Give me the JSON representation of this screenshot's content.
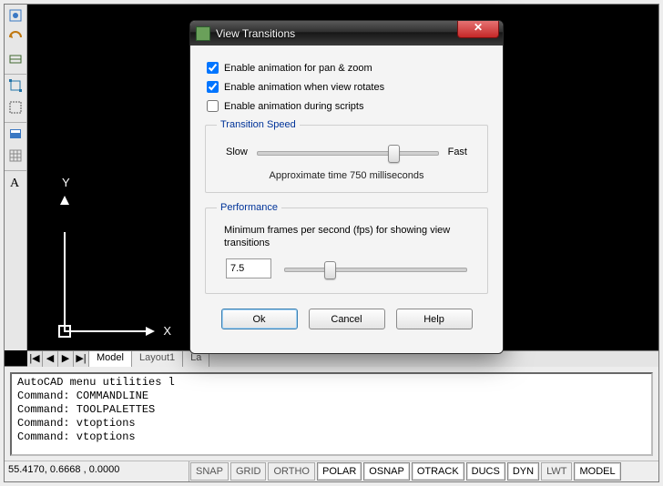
{
  "axis": {
    "x_label": "X",
    "y_label": "Y"
  },
  "model_tabs": {
    "nav": [
      "|◀",
      "◀",
      "▶",
      "▶|"
    ],
    "items": [
      "Model",
      "Layout1",
      "La"
    ]
  },
  "command_window": {
    "lines": [
      "AutoCAD menu utilities l",
      "Command: COMMANDLINE",
      "Command: TOOLPALETTES",
      "Command: vtoptions",
      "Command: vtoptions"
    ]
  },
  "status_bar": {
    "coordinates": "55.4170, 0.6668 , 0.0000",
    "toggles": [
      {
        "label": "SNAP",
        "on": false
      },
      {
        "label": "GRID",
        "on": false
      },
      {
        "label": "ORTHO",
        "on": false
      },
      {
        "label": "POLAR",
        "on": true
      },
      {
        "label": "OSNAP",
        "on": true
      },
      {
        "label": "OTRACK",
        "on": true
      },
      {
        "label": "DUCS",
        "on": true
      },
      {
        "label": "DYN",
        "on": true
      },
      {
        "label": "LWT",
        "on": false
      },
      {
        "label": "MODEL",
        "on": true
      }
    ]
  },
  "dialog": {
    "title": "View Transitions",
    "close_glyph": "✕",
    "checkboxes": [
      {
        "label": "Enable animation for pan & zoom",
        "checked": true
      },
      {
        "label": "Enable animation when view rotates",
        "checked": true
      },
      {
        "label": "Enable animation during scripts",
        "checked": false
      }
    ],
    "speed_group": {
      "legend": "Transition Speed",
      "slow_label": "Slow",
      "fast_label": "Fast",
      "slider_position_pct": 72,
      "approx_text": "Approximate time 750 milliseconds"
    },
    "perf_group": {
      "legend": "Performance",
      "description": "Minimum frames per second (fps) for showing view transitions",
      "fps_value": "7.5",
      "slider_position_pct": 22
    },
    "buttons": {
      "ok": "Ok",
      "cancel": "Cancel",
      "help": "Help"
    }
  }
}
